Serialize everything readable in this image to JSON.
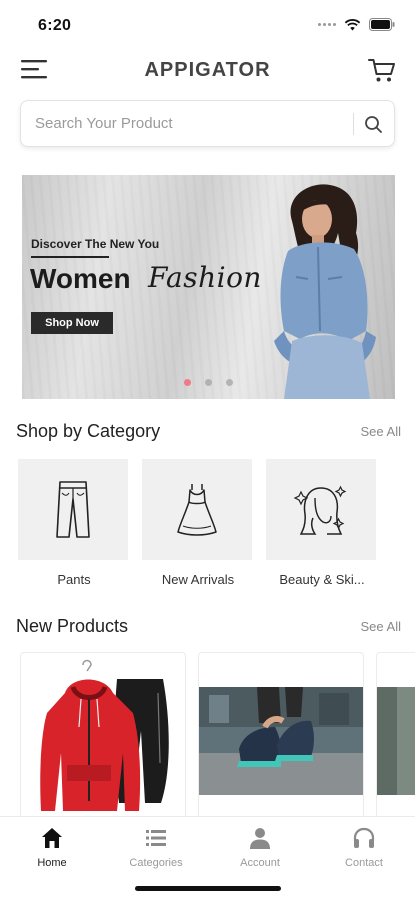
{
  "status_bar": {
    "time": "6:20"
  },
  "header": {
    "title": "APPIGATOR",
    "menu_icon": "hamburger-menu-icon",
    "cart_icon": "shopping-cart-icon"
  },
  "search": {
    "placeholder": "Search Your Product",
    "value": "",
    "icon": "search-icon"
  },
  "banner": {
    "subtitle": "Discover The New You",
    "title_bold": "Women",
    "title_script": "Fashion",
    "button_label": "Shop Now",
    "slide_count": 3,
    "active_slide": 1,
    "accent_color": "#f07b88"
  },
  "categories_section": {
    "title": "Shop by Category",
    "see_all": "See All",
    "items": [
      {
        "label": "Pants",
        "icon": "pants-icon"
      },
      {
        "label": "New Arrivals",
        "icon": "dress-icon"
      },
      {
        "label": "Beauty & Ski...",
        "icon": "beauty-face-icon"
      }
    ]
  },
  "products_section": {
    "title": "New Products",
    "see_all": "See All"
  },
  "bottom_nav": {
    "items": [
      {
        "label": "Home",
        "icon": "home-icon",
        "active": true
      },
      {
        "label": "Categories",
        "icon": "list-icon",
        "active": false
      },
      {
        "label": "Account",
        "icon": "user-icon",
        "active": false
      },
      {
        "label": "Contact",
        "icon": "headphones-icon",
        "active": false
      }
    ]
  }
}
